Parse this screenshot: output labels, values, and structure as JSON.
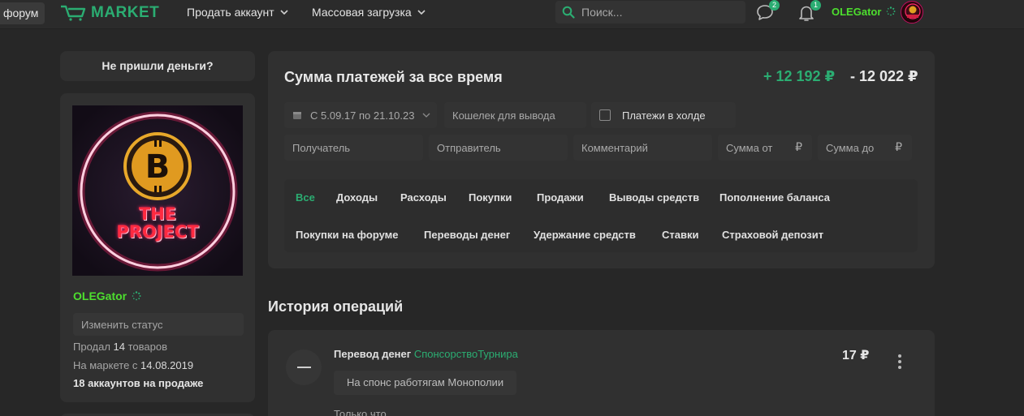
{
  "header": {
    "forum_label": "форум",
    "logo_text": "MARKET",
    "nav": [
      {
        "label": "Продать аккаунт"
      },
      {
        "label": "Массовая загрузка"
      }
    ],
    "search_placeholder": "Поиск...",
    "messages_badge": "2",
    "notifications_badge": "1",
    "username": "OLEGator",
    "colors": {
      "accent": "#2bad72",
      "username": "#4ddf2e"
    }
  },
  "sidebar": {
    "no_money_button": "Не пришли деньги?",
    "profile": {
      "image_text_1": "THE",
      "image_text_2": "PROJECT",
      "username": "OLEGator",
      "status_placeholder": "Изменить статус",
      "sold_prefix": "Продал ",
      "sold_count": "14",
      "sold_suffix": " товаров",
      "since_prefix": "На маркете с ",
      "since_date": "14.08.2019",
      "accounts_on_sale": "18 аккаунтов на продаже"
    }
  },
  "filters": {
    "title": "Сумма платежей за все время",
    "income": "+ 12 192 ₽",
    "expense": "- 12 022 ₽",
    "date_range": "С 5.09.17 по 21.10.23",
    "wallet_placeholder": "Кошелек для вывода",
    "hold_label": "Платежи в холде",
    "recipient_placeholder": "Получатель",
    "sender_placeholder": "Отправитель",
    "comment_placeholder": "Комментарий",
    "sum_from_placeholder": "Сумма от",
    "sum_to_placeholder": "Сумма до",
    "currency": "₽",
    "tabs": [
      {
        "label": "Все",
        "active": true
      },
      {
        "label": "Доходы"
      },
      {
        "label": "Расходы"
      },
      {
        "label": "Покупки"
      },
      {
        "label": "Продажи"
      },
      {
        "label": "Выводы средств"
      },
      {
        "label": "Пополнение баланса"
      },
      {
        "label": "Покупки на форуме"
      },
      {
        "label": "Переводы денег"
      },
      {
        "label": "Удержание средств"
      },
      {
        "label": "Ставки"
      },
      {
        "label": "Страховой депозит"
      }
    ]
  },
  "history": {
    "title": "История операций",
    "operations": [
      {
        "type": "Перевод денег",
        "counterparty": "СпонсорствоТурнира",
        "comment": "На спонс работягам Монополии",
        "time": "Только что",
        "amount": "17 ₽"
      }
    ]
  }
}
